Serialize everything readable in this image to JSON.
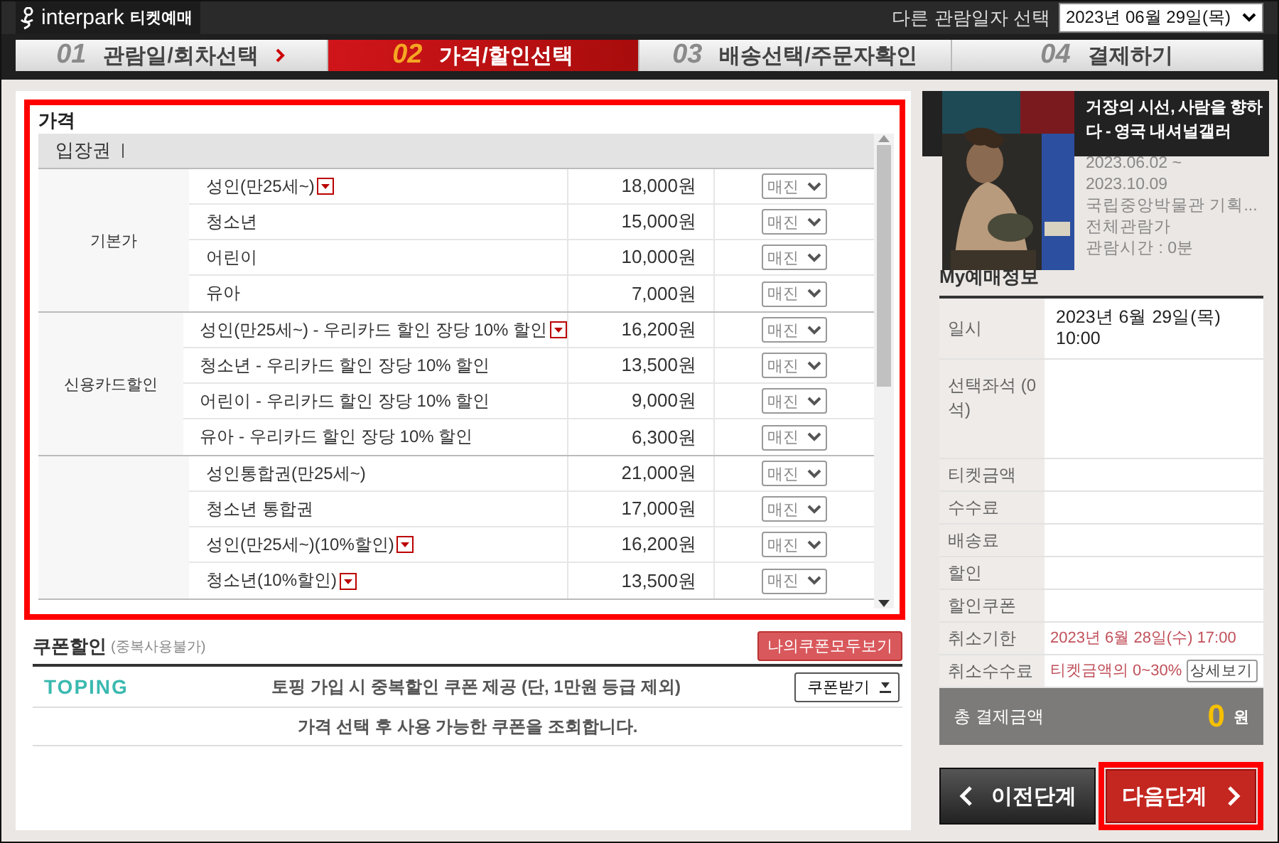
{
  "header": {
    "brand": "interpark",
    "brand_sub": "티켓예매",
    "date_label": "다른 관람일자 선택",
    "date_value": "2023년 06월 29일(목)"
  },
  "steps": [
    {
      "number": "01",
      "label": "관람일/회차선택",
      "selected": false
    },
    {
      "number": "02",
      "label": "가격/할인선택",
      "selected": true
    },
    {
      "number": "03",
      "label": "배송선택/주문자확인",
      "selected": false
    },
    {
      "number": "04",
      "label": "결제하기",
      "selected": false
    }
  ],
  "price": {
    "title": "가격",
    "category": "입장권",
    "groups": [
      {
        "label": "기본가",
        "rows": [
          {
            "name": "성인(만25세~)",
            "info": true,
            "price": "18,000원",
            "option": "매진"
          },
          {
            "name": "청소년",
            "info": false,
            "price": "15,000원",
            "option": "매진"
          },
          {
            "name": "어린이",
            "info": false,
            "price": "10,000원",
            "option": "매진"
          },
          {
            "name": "유아",
            "info": false,
            "price": "7,000원",
            "option": "매진"
          }
        ]
      },
      {
        "label": "신용카드할인",
        "rows": [
          {
            "name": "성인(만25세~) - 우리카드 할인 장당 10% 할인",
            "info": true,
            "price": "16,200원",
            "option": "매진"
          },
          {
            "name": "청소년 - 우리카드 할인 장당 10% 할인",
            "info": false,
            "price": "13,500원",
            "option": "매진"
          },
          {
            "name": "어린이 - 우리카드 할인 장당 10% 할인",
            "info": false,
            "price": "9,000원",
            "option": "매진"
          },
          {
            "name": "유아 - 우리카드 할인 장당 10% 할인",
            "info": false,
            "price": "6,300원",
            "option": "매진"
          }
        ]
      },
      {
        "rows": [
          {
            "name": "성인통합권(만25세~)",
            "info": false,
            "price": "21,000원",
            "option": "매진"
          },
          {
            "name": "청소년 통합권",
            "info": false,
            "price": "17,000원",
            "option": "매진"
          },
          {
            "name": "성인(만25세~)(10%할인)",
            "info": true,
            "price": "16,200원",
            "option": "매진"
          },
          {
            "name": "청소년(10%할인)",
            "info": true,
            "price": "13,500원",
            "option": "매진"
          }
        ]
      }
    ]
  },
  "coupon": {
    "title": "쿠폰할인",
    "note": "(중복사용불가)",
    "all_button": "나의쿠폰모두보기",
    "partner": "TOPING",
    "offer": "토핑 가입 시 중복할인 쿠폰 제공 (단, 1만원 등급 제외)",
    "get_button": "쿠폰받기",
    "message": "가격 선택 후 사용 가능한 쿠폰을 조회합니다."
  },
  "show": {
    "title": "거장의 시선, 사람을 향하다 - 영국 내셔널갤러",
    "lines": [
      "2023.06.02 ~",
      "2023.10.09",
      "국립중앙박물관 기획...",
      "전체관람가",
      "관람시간 : 0분"
    ]
  },
  "my_booking": {
    "title": "My예매정보",
    "rows": [
      {
        "label": "일시",
        "value": "2023년 6월 29일(목) 10:00",
        "kind": "plain"
      },
      {
        "label": "선택좌석 (0석)",
        "kind": "tall"
      },
      {
        "label": "티켓금액",
        "kind": "plain"
      },
      {
        "label": "수수료",
        "kind": "plain"
      },
      {
        "label": "배송료",
        "kind": "plain"
      },
      {
        "label": "할인",
        "kind": "plain"
      },
      {
        "label": "할인쿠폰",
        "kind": "plain"
      },
      {
        "label": "취소기한",
        "value": "2023년 6월 28일(수) 17:00",
        "kind": "alert"
      },
      {
        "label": "취소수수료",
        "value": "티켓금액의 0~30%",
        "button": "상세보기",
        "kind": "alert"
      }
    ],
    "total_label": "총 결제금액",
    "total_value": "0",
    "total_unit": "원"
  },
  "buttons": {
    "prev": "이전단계",
    "next": "다음단계"
  }
}
